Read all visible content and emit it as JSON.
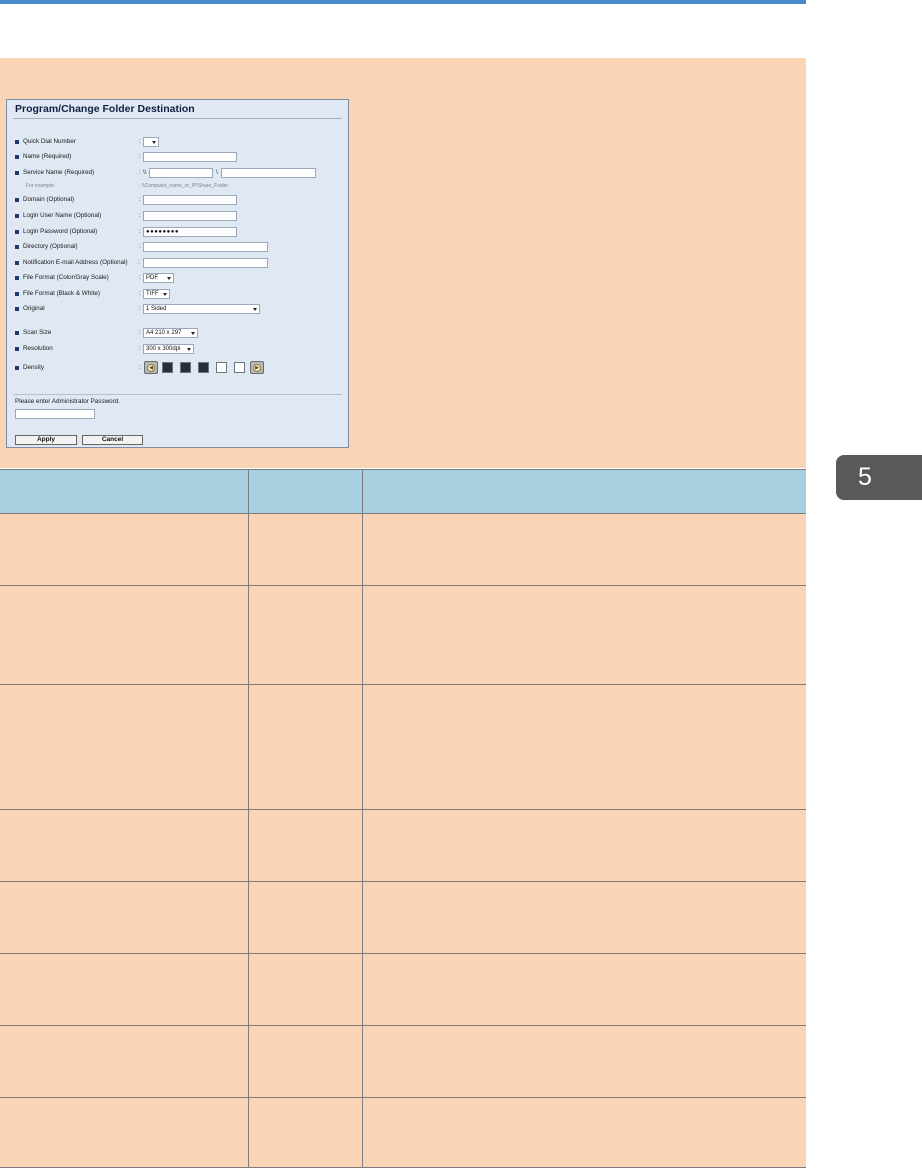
{
  "chapter_tab": "5",
  "dialog": {
    "title": "Program/Change Folder Destination",
    "fields": {
      "quick_dial": "Quick Dial Number",
      "name": "Name (Required)",
      "service_name": "Service Name (Required)",
      "domain": "Domain (Optional)",
      "login_user": "Login User Name (Optional)",
      "login_password": "Login Password (Optional)",
      "directory": "Directory (Optional)",
      "notification": "Notification E-mail Address (Optional)",
      "file_format_color": "File Format (Color/Gray Scale)",
      "file_format_bw": "File Format (Black & White)",
      "original": "Original",
      "scan_size": "Scan Size",
      "resolution": "Resolution",
      "density": "Density"
    },
    "colon": ":",
    "service_prefix": "\\\\",
    "service_separator": "\\",
    "example_label": "For example:",
    "example_value": ": \\\\Computer_name_or_IP\\Share_Folder",
    "password_dots": "●●●●●●●●",
    "values": {
      "file_format_color": "PDF",
      "file_format_bw": "TIFF",
      "original": "1 Sided",
      "scan_size": "A4 210 x 297",
      "resolution": "300 x 300dpi"
    },
    "density_levels": [
      "dark",
      "dark",
      "dark",
      "light",
      "light"
    ],
    "density_down_glyph": "◀",
    "density_up_glyph": "▶",
    "admin_prompt": "Please enter Administrator Password.",
    "apply_label": "Apply",
    "cancel_label": "Cancel"
  },
  "table": {
    "headers": [
      "",
      "",
      ""
    ],
    "rows": [
      [
        "",
        "",
        ""
      ],
      [
        "",
        "",
        ""
      ],
      [
        "",
        "",
        ""
      ],
      [
        "",
        "",
        ""
      ],
      [
        "",
        "",
        ""
      ],
      [
        "",
        "",
        ""
      ],
      [
        "",
        "",
        ""
      ],
      [
        "",
        "",
        ""
      ]
    ]
  }
}
